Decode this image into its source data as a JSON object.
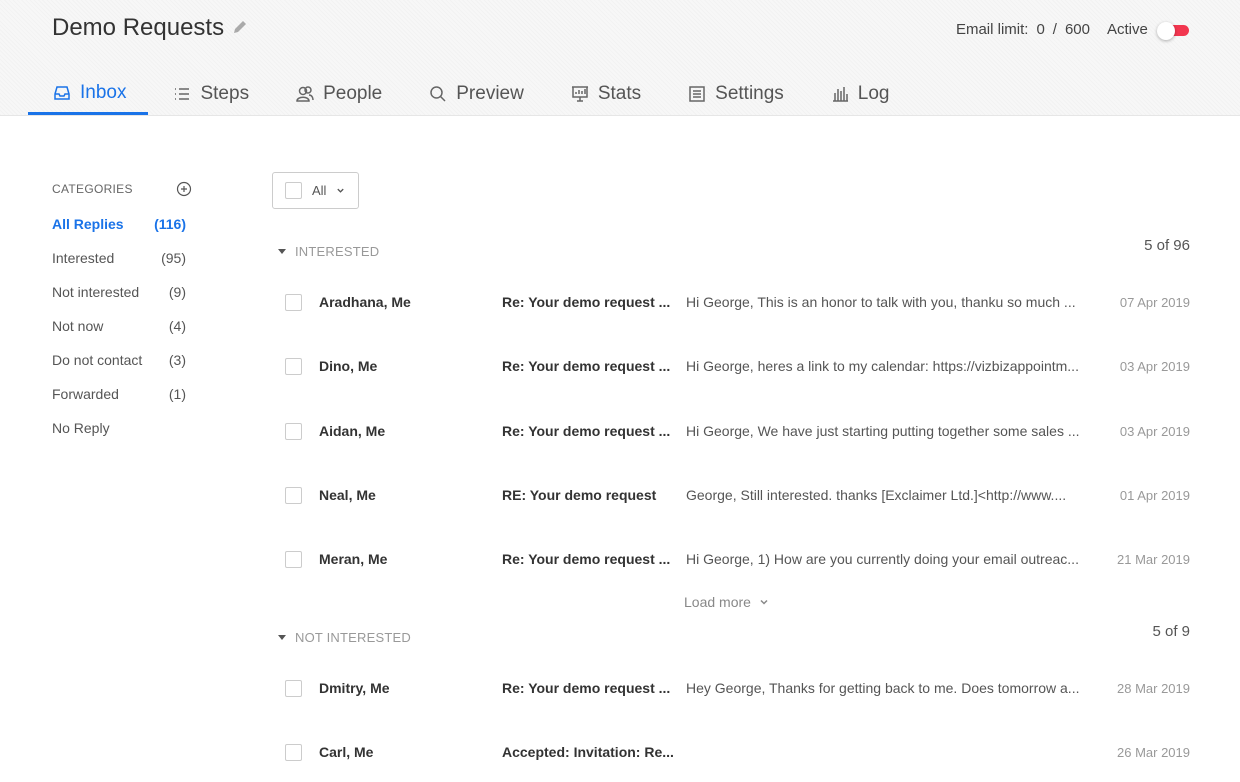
{
  "header": {
    "title": "Demo Requests",
    "email_limit_label": "Email limit:",
    "email_used": "0",
    "email_sep": "/",
    "email_max": "600",
    "active_label": "Active",
    "active_on": true
  },
  "tabs": [
    {
      "label": "Inbox",
      "icon": "inbox-icon",
      "active": true
    },
    {
      "label": "Steps",
      "icon": "list-icon"
    },
    {
      "label": "People",
      "icon": "people-icon"
    },
    {
      "label": "Preview",
      "icon": "search-icon"
    },
    {
      "label": "Stats",
      "icon": "presentation-icon"
    },
    {
      "label": "Settings",
      "icon": "settings-list-icon"
    },
    {
      "label": "Log",
      "icon": "bar-chart-icon"
    }
  ],
  "sidebar": {
    "heading": "CATEGORIES",
    "items": [
      {
        "label": "All Replies",
        "count": "(116)"
      },
      {
        "label": "Interested",
        "count": "(95)"
      },
      {
        "label": "Not interested",
        "count": "(9)"
      },
      {
        "label": "Not now",
        "count": "(4)"
      },
      {
        "label": "Do not contact",
        "count": "(3)"
      },
      {
        "label": "Forwarded",
        "count": "(1)"
      },
      {
        "label": "No Reply",
        "count": ""
      }
    ]
  },
  "filter": {
    "label": "All"
  },
  "sections": [
    {
      "title": "INTERESTED",
      "count": "5 of 96",
      "rows": [
        {
          "name": "Aradhana, Me",
          "subject": "Re: Your demo request ...",
          "snippet": "Hi George,  This is an honor to talk with you, thanku so much ...",
          "date": "07 Apr 2019"
        },
        {
          "name": "Dino, Me",
          "subject": "Re: Your demo request ...",
          "snippet": "Hi George, heres a link to my calendar: https://vizbizappointm...",
          "date": "03 Apr 2019"
        },
        {
          "name": "Aidan, Me",
          "subject": "Re: Your demo request ...",
          "snippet": "Hi George,  We have just starting putting together some sales ...",
          "date": "03 Apr 2019"
        },
        {
          "name": "Neal, Me",
          "subject": "RE: Your demo request",
          "snippet": "George,  Still interested.  thanks   [Exclaimer Ltd.]<http://www....",
          "date": "01 Apr 2019"
        },
        {
          "name": "Meran, Me",
          "subject": "Re: Your demo request ...",
          "snippet": "Hi George,  1) How are you currently doing your email outreac...",
          "date": "21 Mar 2019"
        }
      ],
      "load_more": "Load more"
    },
    {
      "title": "NOT INTERESTED",
      "count": "5 of 9",
      "rows": [
        {
          "name": "Dmitry, Me",
          "subject": "Re: Your demo request ...",
          "snippet": "Hey George, Thanks for getting back to me.  Does tomorrow a...",
          "date": "28 Mar 2019"
        },
        {
          "name": "Carl, Me",
          "subject": "Accepted: Invitation: Re...",
          "snippet": "",
          "date": "26 Mar 2019"
        }
      ]
    }
  ]
}
